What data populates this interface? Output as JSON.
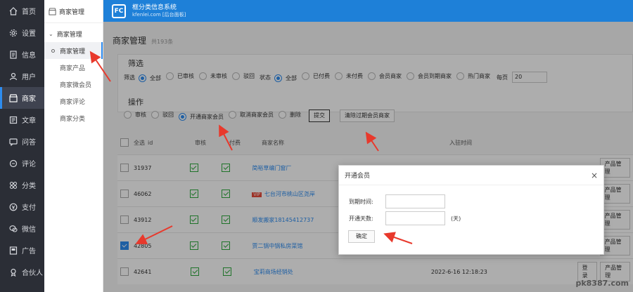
{
  "nav": {
    "items": [
      {
        "label": "首页",
        "icon": "home-icon"
      },
      {
        "label": "设置",
        "icon": "gear-icon"
      },
      {
        "label": "信息",
        "icon": "document-icon"
      },
      {
        "label": "用户",
        "icon": "user-icon"
      },
      {
        "label": "商家",
        "icon": "store-icon"
      },
      {
        "label": "文章",
        "icon": "article-icon"
      },
      {
        "label": "问答",
        "icon": "qa-icon"
      },
      {
        "label": "评论",
        "icon": "comment-icon"
      },
      {
        "label": "分类",
        "icon": "category-icon"
      },
      {
        "label": "支付",
        "icon": "pay-icon"
      },
      {
        "label": "微信",
        "icon": "wechat-icon"
      },
      {
        "label": "广告",
        "icon": "ad-icon"
      },
      {
        "label": "合伙人",
        "icon": "partner-icon"
      }
    ],
    "active_index": 4
  },
  "submenu": {
    "title": "商家管理",
    "group": "商家管理",
    "items": [
      "商家管理",
      "商家产品",
      "商家微会员",
      "商家评论",
      "商家分类"
    ]
  },
  "header": {
    "logo_text": "FC",
    "title": "框分类信息系统",
    "subtitle": "kfenlei.com [后台面板]"
  },
  "page": {
    "title": "商家管理",
    "count": "共193条"
  },
  "filter": {
    "title": "筛选",
    "prefix": "筛选",
    "audit_options": [
      "全部",
      "已审核",
      "未审核",
      "驳回"
    ],
    "status_label": "状态",
    "status_options": [
      "全部",
      "已付费",
      "未付费",
      "会员商家",
      "会员到期商家",
      "热门商家"
    ],
    "perpage_label": "每页",
    "perpage_value": "20"
  },
  "operation": {
    "title": "操作",
    "options": [
      "审核",
      "驳回",
      "开通商家会员",
      "取消商家会员",
      "删除"
    ],
    "submit": "提交",
    "clear": "清除过期会员商家"
  },
  "table": {
    "headers": {
      "select": "全选",
      "id": "id",
      "audit": "审核",
      "paid": "付费",
      "name": "商家名称",
      "time": "入驻时间"
    },
    "rows": [
      {
        "id": "31937",
        "name": "简裕草编门窗厂",
        "time": "",
        "checked": false,
        "vip": false
      },
      {
        "id": "46062",
        "name": "七台河市桃山区尧岸",
        "time": "",
        "checked": false,
        "vip": true
      },
      {
        "id": "43912",
        "name": "顺发搬家18145412737",
        "time": "",
        "checked": false,
        "vip": false
      },
      {
        "id": "42805",
        "name": "贾二锅中锅私房菜馆",
        "time": "",
        "checked": true,
        "vip": false
      },
      {
        "id": "42641",
        "name": "宝莉商场经销处",
        "time": "2022-6-16 12:18:23",
        "checked": false,
        "vip": false
      }
    ],
    "vip_tag": "VIP",
    "login_label": "登录",
    "product_label": "产品管理"
  },
  "modal": {
    "title": "开通会员",
    "expire_label": "到期时间:",
    "days_label": "开通天数:",
    "days_unit": "(天)",
    "confirm": "确定",
    "close": "×"
  },
  "watermark": "pk8387.com",
  "colors": {
    "header": "#1e80d8",
    "nav": "#2b2e36",
    "accent": "#2d8cf0",
    "arrow": "#e8392c"
  }
}
